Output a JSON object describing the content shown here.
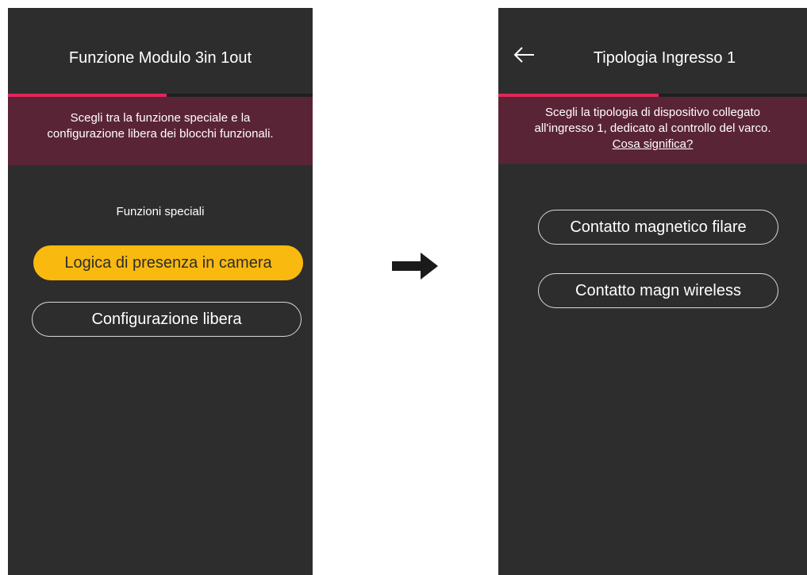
{
  "left_screen": {
    "title": "Funzione Modulo 3in 1out",
    "progress_percent": 52,
    "banner_lines": [
      "Scegli tra la funzione speciale e la",
      "configurazione libera dei blocchi funzionali."
    ],
    "section_label": "Funzioni speciali",
    "primary_button": "Logica di presenza in camera",
    "secondary_button": "Configurazione libera"
  },
  "right_screen": {
    "title": "Tipologia Ingresso 1",
    "progress_percent": 52,
    "banner_lines": [
      "Scegli la tipologia di dispositivo collegato",
      "all'ingresso 1, dedicato al controllo del varco."
    ],
    "banner_link": "Cosa significa?",
    "options": [
      "Contatto magnetico filare",
      "Contatto magn wireless"
    ]
  },
  "colors": {
    "screen_background": "#2d2d2d",
    "progress_accent": "#e0275a",
    "banner_background": "#5a2437",
    "primary_button": "#f9b90f"
  },
  "icons": {
    "back": "arrow-left-icon",
    "flow": "arrow-right-icon"
  }
}
